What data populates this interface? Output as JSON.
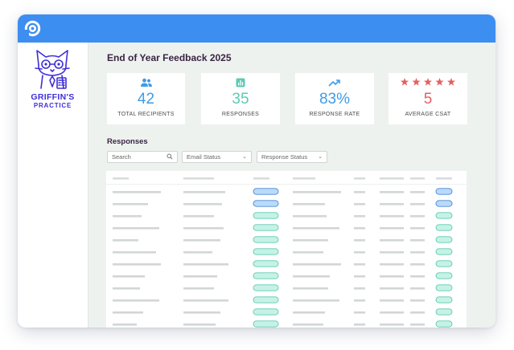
{
  "brand": {
    "line1": "GRIFFIN'S",
    "line2": "PRACTICE",
    "color": "#3f2fd8"
  },
  "colors": {
    "topbar": "#3d8ef1",
    "blue": "#3f9be8",
    "teal": "#5ecab3",
    "red": "#e56060"
  },
  "page": {
    "title": "End of Year Feedback 2025"
  },
  "stats": [
    {
      "icon": "people-icon",
      "value": "42",
      "label": "TOTAL RECIPIENTS"
    },
    {
      "icon": "bar-chart-icon",
      "value": "35",
      "label": "RESPONSES"
    },
    {
      "icon": "trend-up-icon",
      "value": "83%",
      "label": "RESPONSE RATE"
    },
    {
      "icon": "stars-icon",
      "stars": 5,
      "value": "5",
      "label": "AVERAGE CSAT"
    }
  ],
  "responses": {
    "title": "Responses",
    "search_placeholder": "Search",
    "filters": {
      "email_status": "Email Status",
      "response_status": "Response Status"
    },
    "row_count": 12,
    "rows": [
      {
        "email_pill": "blue",
        "response_pill": "blue"
      },
      {
        "email_pill": "blue",
        "response_pill": "blue"
      },
      {
        "email_pill": "teal",
        "response_pill": "teal"
      },
      {
        "email_pill": "teal",
        "response_pill": "teal"
      },
      {
        "email_pill": "teal",
        "response_pill": "teal"
      },
      {
        "email_pill": "teal",
        "response_pill": "teal"
      },
      {
        "email_pill": "teal",
        "response_pill": "teal"
      },
      {
        "email_pill": "teal",
        "response_pill": "teal"
      },
      {
        "email_pill": "teal",
        "response_pill": "teal"
      },
      {
        "email_pill": "teal",
        "response_pill": "teal"
      },
      {
        "email_pill": "teal",
        "response_pill": "teal"
      },
      {
        "email_pill": "teal",
        "response_pill": "teal"
      }
    ]
  }
}
